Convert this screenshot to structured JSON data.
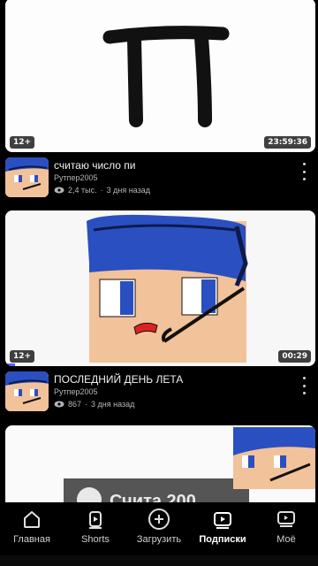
{
  "videos": [
    {
      "title": "считаю число пи",
      "channel": "Рутпер2005",
      "views": "2,4 тыс.",
      "separator": "·",
      "age": "3 дня назад",
      "age_rating": "12+",
      "duration": "23:59:36"
    },
    {
      "title": "ПОСЛЕДНИЙ ДЕНЬ ЛЕТА",
      "channel": "Рутпер2005",
      "views": "867",
      "separator": "·",
      "age": "3 дня назад",
      "age_rating": "12+",
      "duration": "00:29",
      "progress": 0.03
    }
  ],
  "thumbnails": {
    "pi_symbol": "П",
    "third_partial_text": "Счита 200"
  },
  "nav": [
    {
      "label": "Главная",
      "icon": "home-icon"
    },
    {
      "label": "Shorts",
      "icon": "shorts-icon"
    },
    {
      "label": "Загрузить",
      "icon": "upload-plus-icon"
    },
    {
      "label": "Подписки",
      "icon": "subscriptions-icon",
      "active": true
    },
    {
      "label": "Моё",
      "icon": "library-icon"
    }
  ],
  "colors": {
    "background": "#000000",
    "accent": "#3b6dff",
    "character_hair": "#2a4fc0",
    "character_skin": "#f2c29a"
  }
}
